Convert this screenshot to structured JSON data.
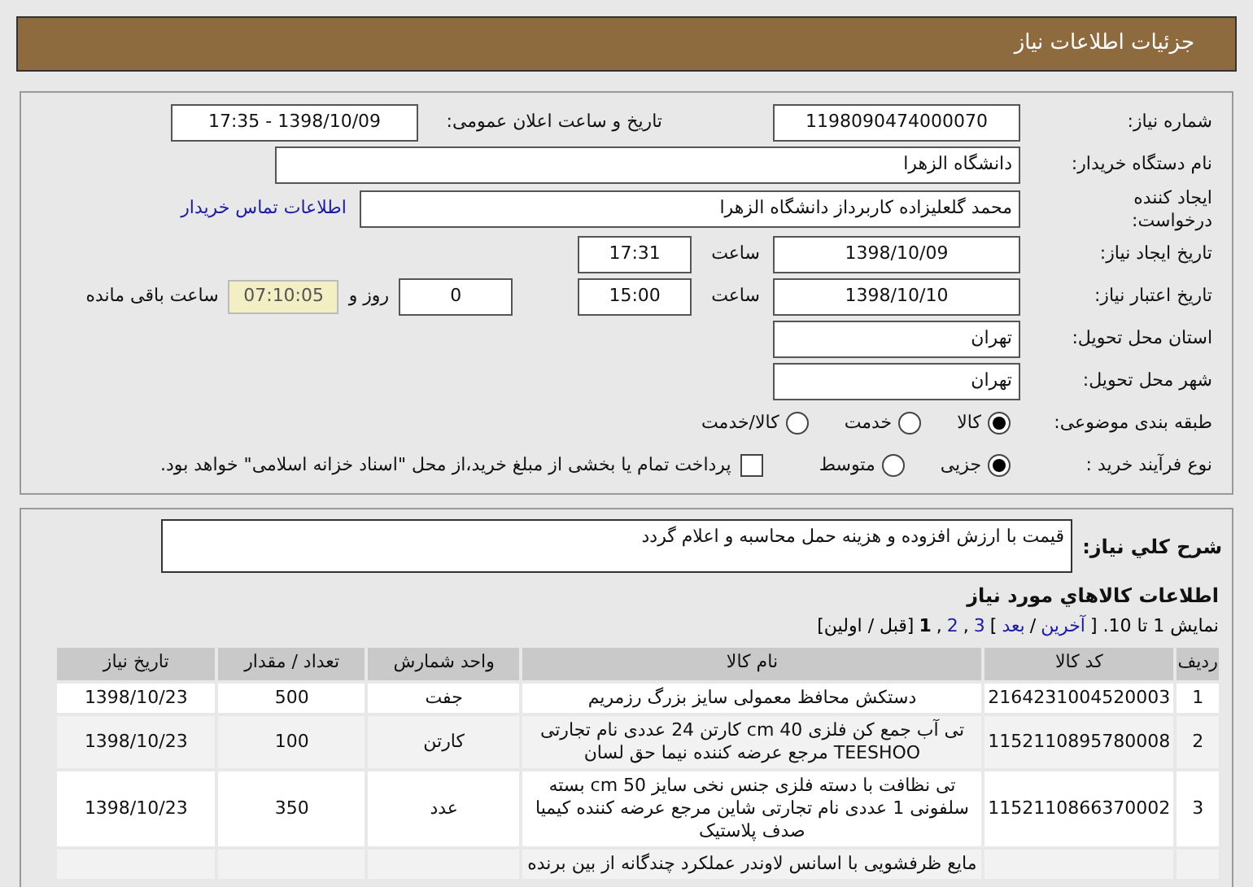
{
  "header": {
    "title": "جزئیات اطلاعات نیاز"
  },
  "need_number": {
    "label": "شماره نیاز:",
    "value": "1198090474000070"
  },
  "announce": {
    "label": "تاریخ و ساعت اعلان عمومی:",
    "value": "1398/10/09 - 17:35"
  },
  "buyer": {
    "label": "نام دستگاه خریدار:",
    "value": "دانشگاه الزهرا"
  },
  "creator": {
    "label": "ایجاد کننده درخواست:",
    "value": "محمد گلعلیزاده کاربرداز دانشگاه الزهرا",
    "link": "اطلاعات تماس خریدار"
  },
  "created": {
    "label": "تاریخ ایجاد نیاز:",
    "date": "1398/10/09",
    "time_label": "ساعت",
    "time": "17:31"
  },
  "validity": {
    "label": "تاریخ اعتبار نیاز:",
    "date": "1398/10/10",
    "time_label": "ساعت",
    "time": "15:00",
    "days": "0",
    "days_label": "روز و",
    "remaining": "07:10:05",
    "remaining_label": "ساعت باقی مانده"
  },
  "province": {
    "label": "استان محل تحویل:",
    "value": "تهران"
  },
  "city": {
    "label": "شهر محل تحویل:",
    "value": "تهران"
  },
  "category": {
    "label": "طبقه بندی موضوعی:",
    "options": [
      {
        "label": "کالا",
        "selected": true
      },
      {
        "label": "خدمت",
        "selected": false
      },
      {
        "label": "کالا/خدمت",
        "selected": false
      }
    ]
  },
  "process": {
    "label": "نوع فرآیند خرید :",
    "options": [
      {
        "label": "جزیی",
        "selected": true
      },
      {
        "label": "متوسط",
        "selected": false
      }
    ],
    "payment": {
      "checked": false,
      "text": "پرداخت تمام یا بخشی از مبلغ خرید،از محل \"اسناد خزانه اسلامی\" خواهد بود."
    }
  },
  "description": {
    "label": "شرح كلي نياز:",
    "value": "قیمت با ارزش افزوده و هزینه حمل محاسبه و اعلام گردد"
  },
  "goods": {
    "title": "اطلاعات كالاهاي مورد نياز",
    "pager": [
      {
        "text": "نمایش 1 تا 10. [",
        "kind": "text"
      },
      {
        "text": "آخرین",
        "kind": "link"
      },
      {
        "text": "/",
        "kind": "text"
      },
      {
        "text": "بعد",
        "kind": "link"
      },
      {
        "text": "]",
        "kind": "text"
      },
      {
        "text": "3",
        "kind": "link"
      },
      {
        "text": ",",
        "kind": "text"
      },
      {
        "text": "2",
        "kind": "link"
      },
      {
        "text": ",",
        "kind": "text"
      },
      {
        "text": "1",
        "kind": "current"
      },
      {
        "text": "[قبل / اولین]",
        "kind": "text"
      }
    ],
    "columns": [
      "ردیف",
      "کد کالا",
      "نام کالا",
      "واحد شمارش",
      "تعداد / مقدار",
      "تاریخ نیاز"
    ],
    "rows": [
      {
        "index": "1",
        "code": "2164231004520003",
        "name": "دستکش محافظ معمولی سایز بزرگ رزمریم",
        "unit": "جفت",
        "qty": "500",
        "date": "1398/10/23"
      },
      {
        "index": "2",
        "code": "1152110895780008",
        "name": "تی آب جمع کن فلزی 40 cm کارتن 24 عددی نام تجارتی TEESHOO مرجع عرضه کننده نیما حق لسان",
        "unit": "کارتن",
        "qty": "100",
        "date": "1398/10/23"
      },
      {
        "index": "3",
        "code": "1152110866370002",
        "name": "تی نظافت با دسته فلزی جنس نخی سایز 50 cm بسته سلفونی 1 عددی نام تجارتی شاین مرجع عرضه کننده کیمیا صدف پلاستیک",
        "unit": "عدد",
        "qty": "350",
        "date": "1398/10/23"
      },
      {
        "name": "مایع ظرفشویی با اسانس لاوندر عملکرد چندگانه از بین برنده"
      }
    ]
  }
}
